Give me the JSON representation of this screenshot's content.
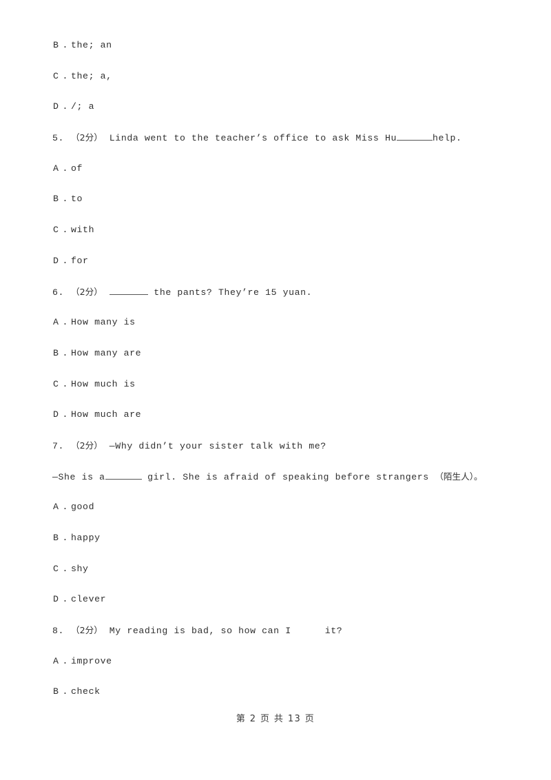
{
  "document": {
    "page_label": "第 2 页 共 13 页",
    "page_number": "2",
    "total_pages": "13",
    "background_color": "#ffffff",
    "text_color": "#2f2f2f"
  },
  "orphan_options": [
    {
      "letter": "B",
      "dot": ".",
      "text": "the; an"
    },
    {
      "letter": "C",
      "dot": ".",
      "text": "the; a,"
    },
    {
      "letter": "D",
      "dot": ".",
      "text": "/; a"
    }
  ],
  "questions": [
    {
      "number": "5.",
      "marks": "（2分）",
      "stem_before": "Linda went to the teacher’s office to ask Miss Hu ",
      "blank": "underline",
      "stem_after": "help.",
      "options": [
        {
          "letter": "A",
          "dot": ".",
          "text": "of"
        },
        {
          "letter": "B",
          "dot": ".",
          "text": "to"
        },
        {
          "letter": "C",
          "dot": ".",
          "text": "with"
        },
        {
          "letter": "D",
          "dot": ".",
          "text": "for"
        }
      ]
    },
    {
      "number": "6.",
      "marks": "（2分）",
      "stem_before": "",
      "blank": "underline",
      "stem_after": " the pants? They’re 15 yuan.",
      "options": [
        {
          "letter": "A",
          "dot": ".",
          "text": "How many is"
        },
        {
          "letter": "B",
          "dot": ".",
          "text": "How many are"
        },
        {
          "letter": "C",
          "dot": ".",
          "text": "How much is"
        },
        {
          "letter": "D",
          "dot": ".",
          "text": "How much are"
        }
      ]
    },
    {
      "number": "7.",
      "marks": "（2分）",
      "stem_before": "—Why didn’t your sister talk with me?",
      "blank": "none",
      "stem_after": "",
      "continuation_before": "—She is a ",
      "continuation_blank": "underline",
      "continuation_after_a": " girl. She is afraid of speaking before strangers ",
      "continuation_cjk": "（陌生人）。",
      "options": [
        {
          "letter": "A",
          "dot": ".",
          "text": "good"
        },
        {
          "letter": "B",
          "dot": ".",
          "text": "happy"
        },
        {
          "letter": "C",
          "dot": ".",
          "text": "shy"
        },
        {
          "letter": "D",
          "dot": ".",
          "text": "clever"
        }
      ]
    },
    {
      "number": "8.",
      "marks": "（2分）",
      "stem_before": "My reading is bad, so how can I",
      "blank": "gap",
      "stem_after": "it?",
      "options": [
        {
          "letter": "A",
          "dot": ".",
          "text": "improve"
        },
        {
          "letter": "B",
          "dot": ".",
          "text": "check"
        }
      ]
    }
  ]
}
